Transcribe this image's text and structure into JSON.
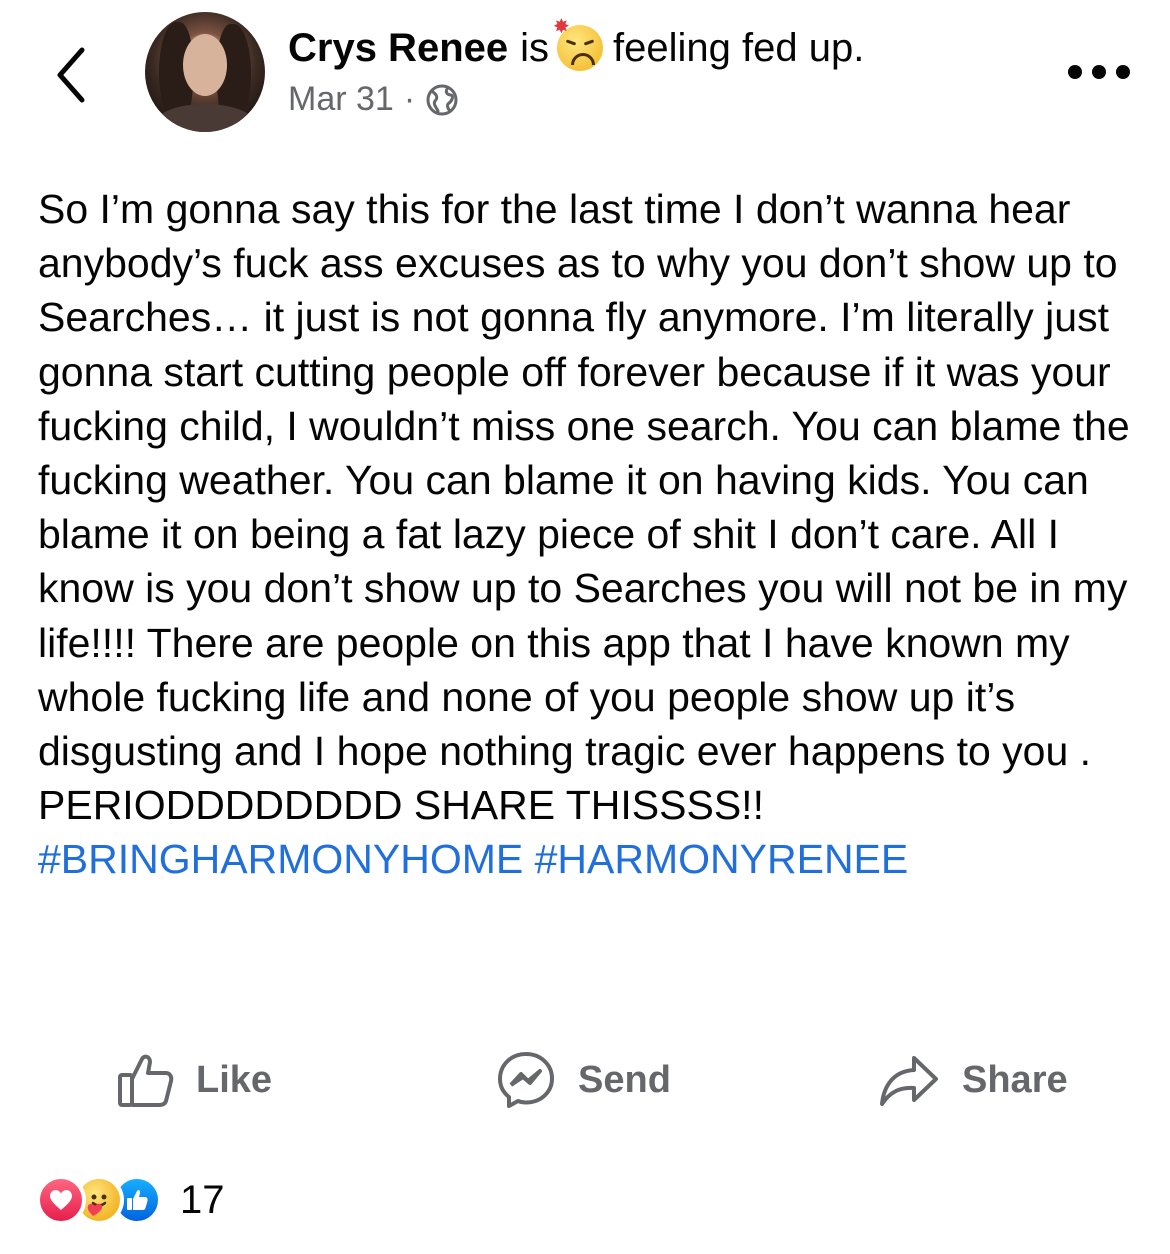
{
  "header": {
    "author_name": "Crys Renee",
    "is_word": "is",
    "feeling_text": "feeling fed up.",
    "feeling_emoji": "tired-face-emoji",
    "date": "Mar 31",
    "separator": "·",
    "privacy_icon": "globe-icon"
  },
  "post": {
    "body_text": "So I’m gonna say this for the last time I don’t wanna hear anybody’s fuck ass excuses as to why you don’t show up to Searches… it just is not gonna fly anymore. I’m literally just gonna start cutting people off forever because if it was your fucking child, I wouldn’t miss one search. You can blame the fucking weather. You can blame it on having kids. You can blame it on being a fat lazy piece of shit I don’t care. All I know is you don’t show up to Searches you will not be in my life!!!! There are people on this app that I have known my whole fucking life and none of you people show up it’s disgusting and I hope nothing tragic ever happens to you . PERIODDDDDDDD SHARE THISSSS!! ",
    "hashtag1": "#BRINGHARMONYHOME",
    "hashtag2": "#HARMONYRENEE",
    "link_color": "#216fdb"
  },
  "actions": {
    "like_label": "Like",
    "send_label": "Send",
    "share_label": "Share"
  },
  "reactions": {
    "types": [
      "love",
      "care",
      "like"
    ],
    "count": "17"
  },
  "colors": {
    "text": "#050505",
    "secondary": "#65676b",
    "love": "#f33e58",
    "like": "#1877f2"
  }
}
